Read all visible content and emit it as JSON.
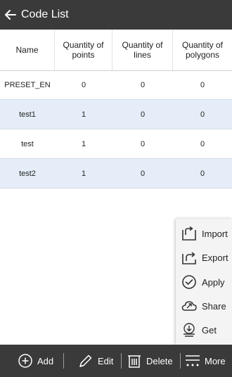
{
  "header": {
    "title": "Code List",
    "back_icon": "arrow-left-icon"
  },
  "table": {
    "columns": [
      "Name",
      "Quantity of points",
      "Quantity of lines",
      "Quantity of polygons"
    ],
    "rows": [
      {
        "name": "PRESET_EN",
        "points": "0",
        "lines": "0",
        "polygons": "0"
      },
      {
        "name": "test1",
        "points": "1",
        "lines": "0",
        "polygons": "0"
      },
      {
        "name": "test",
        "points": "1",
        "lines": "0",
        "polygons": "0"
      },
      {
        "name": "test2",
        "points": "1",
        "lines": "0",
        "polygons": "0"
      }
    ]
  },
  "menu": {
    "items": [
      {
        "label": "Import",
        "icon": "import-icon"
      },
      {
        "label": "Export",
        "icon": "export-icon"
      },
      {
        "label": "Apply",
        "icon": "check-circle-icon"
      },
      {
        "label": "Share",
        "icon": "share-cloud-icon"
      },
      {
        "label": "Get",
        "icon": "download-icon"
      }
    ]
  },
  "toolbar": {
    "add_label": "Add",
    "edit_label": "Edit",
    "delete_label": "Delete",
    "more_label": "More"
  },
  "colors": {
    "bar_background": "#3a3a3a",
    "alt_row": "#e5eef8",
    "menu_background": "#f4f4f4"
  }
}
